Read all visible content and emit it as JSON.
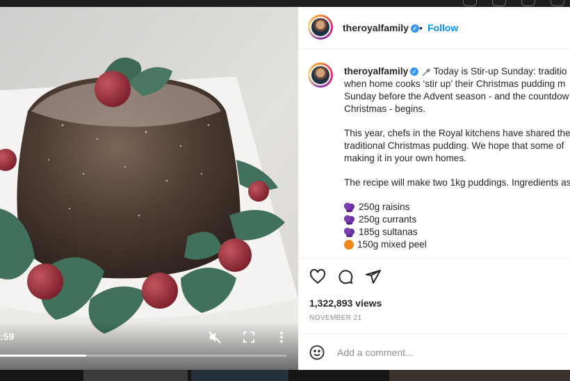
{
  "post": {
    "username": "theroyalfamily",
    "follow_label": "Follow",
    "separator": "•"
  },
  "video": {
    "time": ":59",
    "progress": 0.3
  },
  "caption": {
    "username": "theroyalfamily",
    "lines": [
      "Today is Stir-up Sunday: traditio",
      "when home cooks ‘stir up’ their Christmas pudding m",
      "Sunday before the Advent season - and the countdow",
      "Christmas - begins."
    ],
    "para2": [
      "This year, chefs in the Royal kitchens have shared thei",
      "traditional Christmas pudding. We hope that some of",
      "making it in your own homes."
    ],
    "para3": "The recipe will make two 1kg puddings. Ingredients as",
    "ingredients": [
      {
        "icon": "grape-icon",
        "text": "250g raisins"
      },
      {
        "icon": "grape-icon",
        "text": "250g currants"
      },
      {
        "icon": "grape-icon",
        "text": "185g sultanas"
      },
      {
        "icon": "orange-icon",
        "text": "150g mixed peel"
      }
    ]
  },
  "stats": {
    "views": "1,322,893 views",
    "date": "NOVEMBER 21"
  },
  "comment": {
    "placeholder": "Add a comment..."
  },
  "colors": {
    "link": "#0095f6",
    "verified": "#3897f0",
    "text": "#262626",
    "muted": "#8e8e8e"
  }
}
